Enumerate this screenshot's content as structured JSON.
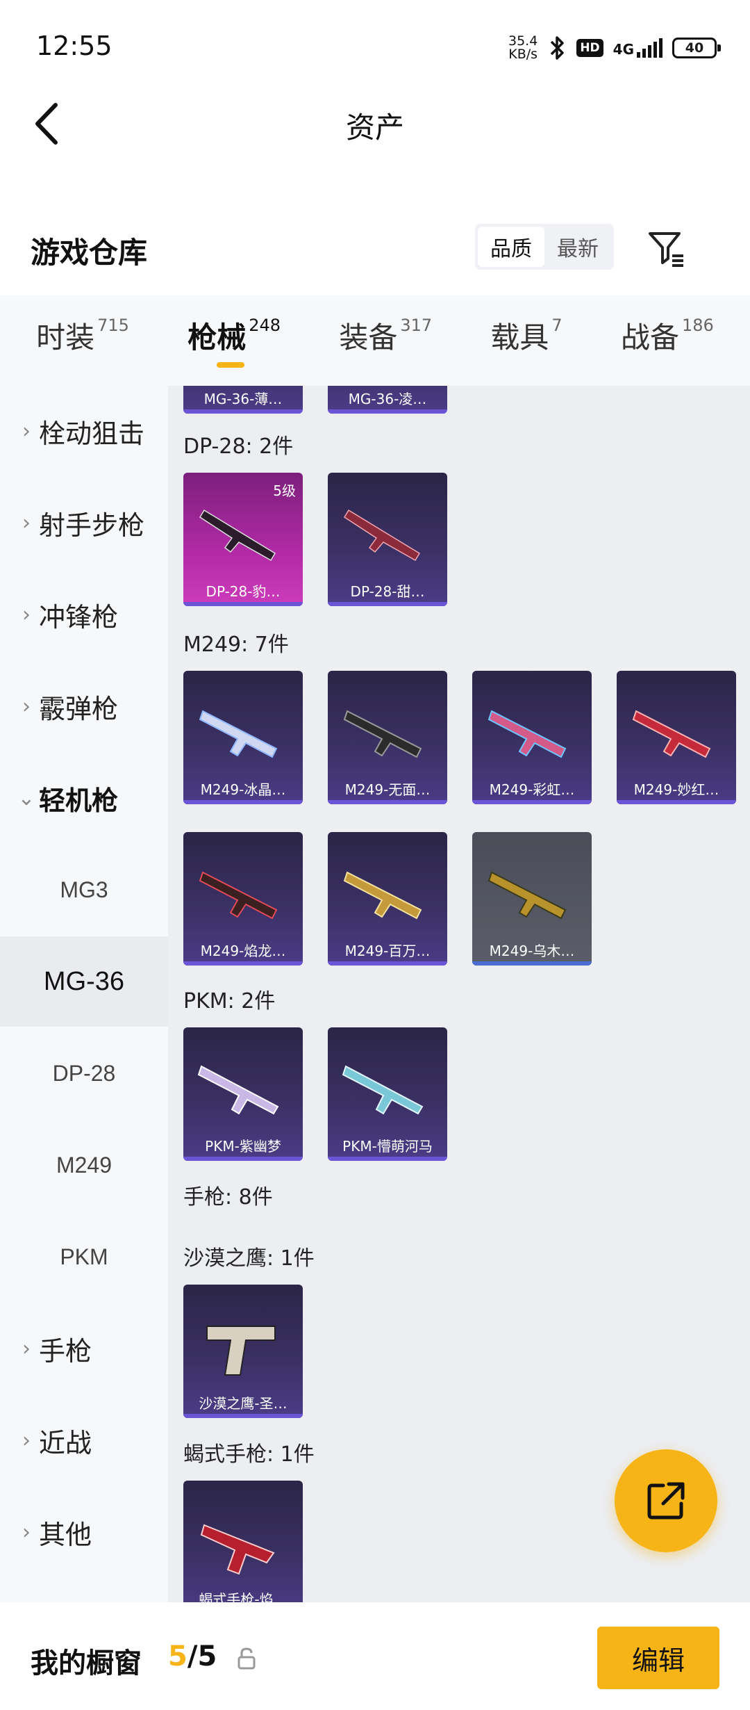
{
  "status_bar": {
    "time": "12:55",
    "net_speed_value": "35.4",
    "net_speed_unit": "KB/s",
    "hd": "HD",
    "network": "4G",
    "battery": "40"
  },
  "header": {
    "title": "资产"
  },
  "warehouse": {
    "title": "游戏仓库",
    "sort_options": [
      "品质",
      "最新"
    ],
    "active_sort": "品质"
  },
  "tabs": [
    {
      "label": "时装",
      "count": "715"
    },
    {
      "label": "枪械",
      "count": "248"
    },
    {
      "label": "装备",
      "count": "317"
    },
    {
      "label": "载具",
      "count": "7"
    },
    {
      "label": "战备",
      "count": "186"
    }
  ],
  "active_tab": "枪械",
  "sidebar": {
    "categories": [
      {
        "label": "栓动狙击"
      },
      {
        "label": "射手步枪"
      },
      {
        "label": "冲锋枪"
      },
      {
        "label": "霰弹枪"
      },
      {
        "label": "轻机枪"
      },
      {
        "label": "手枪"
      },
      {
        "label": "近战"
      },
      {
        "label": "其他"
      }
    ],
    "sub_items": [
      "MG3",
      "MG-36",
      "DP-28",
      "M249",
      "PKM"
    ],
    "selected_sub": "MG-36"
  },
  "content": {
    "top_partial": [
      "MG-36-薄…",
      "MG-36-凌…"
    ],
    "groups": [
      {
        "title": "DP-28: 2件",
        "items": [
          {
            "name": "DP-28-豹…",
            "level": "5级"
          },
          {
            "name": "DP-28-甜…"
          }
        ]
      },
      {
        "title": "M249: 7件",
        "items": [
          {
            "name": "M249-冰晶…"
          },
          {
            "name": "M249-无面…"
          },
          {
            "name": "M249-彩虹…"
          },
          {
            "name": "M249-妙红…"
          },
          {
            "name": "M249-焰龙…"
          },
          {
            "name": "M249-百万…"
          },
          {
            "name": "M249-乌木…"
          }
        ]
      },
      {
        "title": "PKM: 2件",
        "items": [
          {
            "name": "PKM-紫幽梦"
          },
          {
            "name": "PKM-懵萌河马"
          }
        ]
      },
      {
        "title": "手枪: 8件",
        "items": []
      },
      {
        "title": "沙漠之鹰: 1件",
        "items": [
          {
            "name": "沙漠之鹰-圣…"
          }
        ]
      },
      {
        "title": "蝎式手枪: 1件",
        "items": [
          {
            "name": "蝎式手枪-焰…"
          }
        ]
      }
    ]
  },
  "bottom_bar": {
    "showcase_label": "我的橱窗",
    "showcase_current": "5",
    "showcase_total": "/5",
    "edit_label": "编辑"
  },
  "colors": {
    "accent": "#f6b417",
    "card_purple": "#3a3063",
    "card_gold": "#b22aa6",
    "card_gray": "#5b5e68"
  }
}
